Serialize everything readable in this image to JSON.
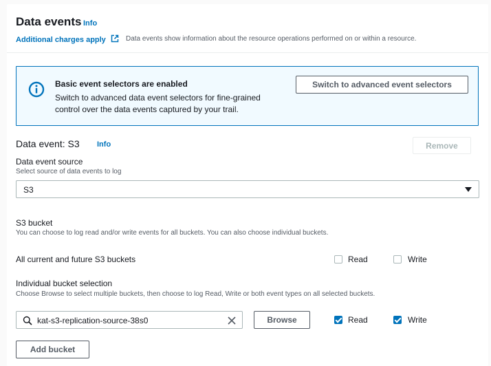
{
  "section": {
    "title": "Data events",
    "info": "Info",
    "charges_link": "Additional charges apply",
    "description": "Data events show information about the resource operations performed on or within a resource."
  },
  "alert": {
    "title": "Basic event selectors are enabled",
    "body": "Switch to advanced data event selectors for fine-grained control over the data events captured by your trail.",
    "button": "Switch to advanced event selectors"
  },
  "data_event": {
    "title": "Data event: S3",
    "info": "Info",
    "remove_button": "Remove",
    "source_label": "Data event source",
    "source_hint": "Select source of data events to log",
    "source_value": "S3"
  },
  "bucket": {
    "title": "S3 bucket",
    "hint": "You can choose to log read and/or write events for all buckets. You can also choose individual buckets.",
    "all_label": "All current and future S3 buckets",
    "all_read": "Read",
    "all_write": "Write",
    "all_read_checked": false,
    "all_write_checked": false,
    "individual_label": "Individual bucket selection",
    "individual_hint": "Choose Browse to select multiple buckets, then choose to log Read, Write or both event types on all selected buckets.",
    "search_value": "kat-s3-replication-source-38s0",
    "browse_button": "Browse",
    "ind_read": "Read",
    "ind_write": "Write",
    "ind_read_checked": true,
    "ind_write_checked": true,
    "add_button": "Add bucket"
  },
  "colors": {
    "link": "#0073bb",
    "alert_bg": "#f1faff",
    "alert_border": "#0073bb",
    "checkbox": "#0073bb"
  }
}
